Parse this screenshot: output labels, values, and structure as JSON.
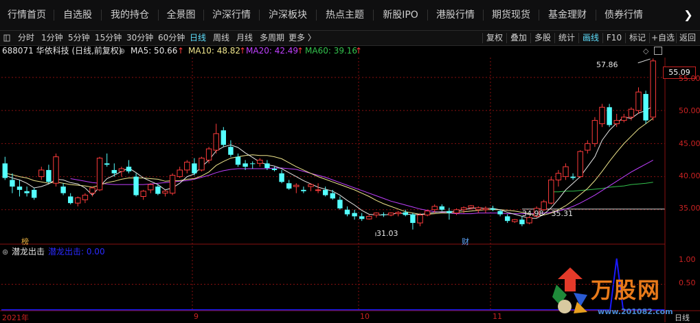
{
  "nav": {
    "items": [
      "行情首页",
      "自选股",
      "我的持仓",
      "全景图",
      "沪深行情",
      "沪深板块",
      "热点主题",
      "新股IPO",
      "港股行情",
      "期货现货",
      "基金理财",
      "债券行情"
    ],
    "next_arrow": "❯"
  },
  "toolbar": {
    "periods": [
      "分时",
      "1分钟",
      "5分钟",
      "15分钟",
      "30分钟",
      "60分钟",
      "日线",
      "周线",
      "月线",
      "多周期",
      "更多 〉"
    ],
    "active_period": "日线",
    "right_buttons": [
      "复权",
      "叠加",
      "多股",
      "统计",
      "画线",
      "F10",
      "标记",
      "+自选",
      "返回"
    ],
    "active_right": "画线"
  },
  "stock": {
    "code_name": "688071 华依科技 (日线,前复权)",
    "ma5": "MA5: 50.66",
    "ma10": "MA10: 48.82",
    "ma20": "MA20: 42.49",
    "ma60": "MA60: 39.16"
  },
  "colors": {
    "up": "#ff3b3b",
    "down": "#54ffff",
    "ma5": "#e6e6e6",
    "ma10": "#f0e68c",
    "ma20": "#c040ff",
    "ma60": "#33c24d",
    "grid": "#8a1010",
    "indicator": "#1a1aff"
  },
  "price_axis": {
    "current": "55.09",
    "ticks": [
      "55.00",
      "50.00",
      "45.00",
      "40.00",
      "35.00"
    ]
  },
  "annotations": {
    "high": "57.86",
    "low": "31.03",
    "range": "34.98 - 35.31",
    "tag_bang": "榜",
    "tag_cai": "财"
  },
  "indicator": {
    "name": "潜龙出击",
    "value_label": "潜龙出击: 0.00",
    "ticks": [
      "1.00",
      "0.50"
    ]
  },
  "x_axis": {
    "labels": [
      "2021年",
      "9",
      "10",
      "11"
    ],
    "period": "日线"
  },
  "watermark": {
    "brand": "万股网",
    "url": "www.201082.com"
  },
  "chart_data": {
    "type": "candlestick",
    "ylim": [
      30,
      58
    ],
    "candles": [
      [
        42.0,
        43.0,
        39.5,
        39.8
      ],
      [
        39.5,
        40.5,
        37.5,
        38.5
      ],
      [
        38.5,
        39.5,
        37.0,
        38.0
      ],
      [
        37.8,
        38.5,
        37.0,
        37.5
      ],
      [
        38.0,
        38.3,
        36.5,
        36.8
      ],
      [
        40.0,
        41.5,
        39.5,
        41.0
      ],
      [
        41.0,
        41.8,
        39.0,
        39.2
      ],
      [
        39.0,
        43.5,
        38.5,
        43.0
      ],
      [
        38.5,
        39.0,
        37.2,
        37.5
      ],
      [
        37.0,
        37.5,
        35.8,
        36.0
      ],
      [
        36.0,
        37.0,
        35.5,
        36.8
      ],
      [
        36.5,
        37.5,
        36.0,
        37.2
      ],
      [
        37.5,
        38.5,
        37.0,
        38.3
      ],
      [
        38.0,
        43.0,
        37.8,
        42.8
      ],
      [
        42.0,
        43.5,
        41.5,
        41.8
      ],
      [
        41.0,
        42.0,
        40.0,
        40.5
      ],
      [
        40.8,
        41.5,
        40.0,
        41.2
      ],
      [
        41.5,
        42.5,
        40.5,
        40.8
      ],
      [
        40.0,
        40.5,
        37.0,
        37.2
      ],
      [
        37.0,
        38.0,
        36.5,
        37.8
      ],
      [
        38.0,
        39.0,
        37.5,
        38.8
      ],
      [
        38.5,
        38.8,
        37.2,
        37.4
      ],
      [
        37.5,
        38.0,
        37.0,
        37.8
      ],
      [
        37.5,
        40.5,
        37.2,
        40.2
      ],
      [
        40.0,
        41.5,
        39.8,
        41.0
      ],
      [
        41.0,
        42.5,
        40.5,
        42.2
      ],
      [
        42.0,
        42.8,
        40.2,
        40.5
      ],
      [
        41.0,
        43.0,
        40.8,
        42.8
      ],
      [
        42.5,
        44.5,
        42.0,
        44.2
      ],
      [
        44.0,
        48.0,
        43.5,
        46.5
      ],
      [
        47.0,
        47.5,
        44.5,
        44.8
      ],
      [
        44.5,
        45.5,
        43.0,
        43.3
      ],
      [
        43.0,
        43.5,
        41.5,
        41.8
      ],
      [
        42.0,
        42.5,
        41.0,
        41.5
      ],
      [
        42.0,
        42.3,
        41.2,
        41.9
      ],
      [
        42.0,
        42.8,
        41.5,
        42.5
      ],
      [
        42.0,
        42.5,
        41.0,
        41.3
      ],
      [
        41.2,
        41.5,
        40.8,
        41.0
      ],
      [
        40.5,
        41.0,
        39.0,
        39.2
      ],
      [
        39.0,
        39.5,
        38.0,
        38.2
      ],
      [
        38.5,
        39.0,
        37.5,
        38.7
      ],
      [
        38.0,
        38.5,
        37.5,
        37.8
      ],
      [
        38.5,
        39.0,
        37.8,
        38.8
      ],
      [
        38.0,
        39.0,
        37.5,
        38.0
      ],
      [
        38.0,
        38.5,
        37.0,
        37.2
      ],
      [
        37.5,
        38.0,
        36.5,
        36.7
      ],
      [
        36.5,
        37.0,
        35.0,
        35.2
      ],
      [
        35.0,
        35.5,
        34.0,
        34.3
      ],
      [
        34.5,
        35.0,
        33.5,
        34.0
      ],
      [
        34.0,
        34.5,
        33.3,
        33.6
      ],
      [
        33.6,
        34.2,
        33.5,
        34.0
      ],
      [
        34.2,
        34.6,
        33.8,
        34.5
      ],
      [
        34.3,
        34.6,
        33.9,
        34.2
      ],
      [
        34.2,
        34.6,
        34.0,
        34.5
      ],
      [
        34.4,
        34.8,
        34.0,
        34.6
      ],
      [
        34.6,
        35.0,
        34.0,
        34.2
      ],
      [
        34.3,
        34.5,
        32.0,
        33.0
      ],
      [
        33.0,
        34.5,
        32.5,
        34.2
      ],
      [
        34.2,
        35.0,
        34.0,
        34.8
      ],
      [
        35.0,
        35.8,
        34.5,
        35.5
      ],
      [
        35.5,
        35.8,
        34.8,
        35.0
      ],
      [
        34.8,
        35.3,
        33.5,
        34.5
      ],
      [
        34.5,
        35.2,
        34.2,
        35.0
      ],
      [
        35.0,
        35.5,
        34.5,
        35.3
      ],
      [
        35.3,
        35.7,
        35.0,
        35.6
      ],
      [
        35.0,
        35.5,
        34.5,
        35.3
      ],
      [
        35.0,
        35.5,
        34.5,
        35.2
      ],
      [
        35.2,
        35.6,
        34.8,
        35.0
      ],
      [
        34.8,
        35.0,
        34.0,
        34.3
      ],
      [
        34.0,
        34.3,
        33.0,
        33.3
      ],
      [
        33.2,
        33.6,
        33.0,
        33.5
      ],
      [
        33.5,
        34.0,
        32.5,
        32.8
      ],
      [
        33.0,
        34.0,
        32.8,
        33.8
      ],
      [
        34.0,
        35.5,
        33.8,
        35.2
      ],
      [
        35.0,
        36.5,
        34.8,
        36.2
      ],
      [
        36.0,
        40.0,
        35.8,
        39.5
      ],
      [
        39.5,
        41.0,
        38.5,
        40.5
      ],
      [
        40.0,
        42.0,
        39.5,
        41.5
      ],
      [
        40.0,
        40.5,
        39.5,
        39.8
      ],
      [
        40.0,
        44.0,
        39.8,
        43.8
      ],
      [
        44.0,
        45.5,
        43.5,
        45.0
      ],
      [
        45.0,
        49.0,
        44.5,
        48.5
      ],
      [
        48.0,
        51.0,
        47.5,
        50.5
      ],
      [
        50.5,
        51.0,
        47.5,
        47.8
      ],
      [
        48.0,
        49.5,
        47.5,
        48.5
      ],
      [
        48.5,
        49.5,
        48.2,
        49.0
      ],
      [
        49.0,
        50.5,
        48.5,
        50.2
      ],
      [
        50.0,
        53.5,
        49.5,
        52.8
      ],
      [
        52.5,
        53.0,
        48.0,
        48.5
      ],
      [
        49.0,
        57.86,
        48.5,
        57.5
      ]
    ],
    "ma5": [
      40.2,
      39.8,
      39.5,
      39.0,
      38.3,
      38.5,
      38.9,
      39.6,
      39.5,
      39.1,
      38.9,
      38.3,
      37.2,
      38.5,
      39.7,
      40.2,
      40.8,
      41.3,
      40.6,
      39.8,
      39.3,
      38.8,
      38.0,
      38.3,
      39.0,
      40.0,
      40.4,
      41.5,
      42.5,
      43.9,
      44.5,
      44.8,
      44.4,
      43.6,
      42.9,
      42.2,
      41.8,
      41.6,
      41.2,
      40.6,
      40.0,
      39.4,
      38.9,
      38.4,
      38.1,
      37.8,
      37.2,
      36.4,
      35.7,
      34.9,
      34.3,
      34.2,
      34.2,
      34.3,
      34.5,
      34.4,
      34.2,
      34.3,
      34.4,
      34.6,
      34.7,
      34.7,
      34.8,
      35.0,
      35.2,
      35.3,
      35.2,
      35.2,
      35.0,
      34.6,
      34.3,
      34.0,
      33.7,
      33.7,
      34.3,
      35.3,
      36.6,
      38.0,
      39.0,
      40.0,
      41.5,
      43.0,
      45.5,
      47.0,
      48.1,
      49.0,
      48.8,
      49.6,
      50.0,
      50.66
    ],
    "ma10": [
      40.5,
      40.3,
      40.0,
      39.8,
      39.4,
      39.2,
      39.0,
      39.2,
      39.0,
      38.8,
      38.7,
      38.6,
      38.4,
      38.7,
      39.1,
      39.3,
      39.6,
      39.8,
      39.8,
      39.8,
      39.7,
      39.6,
      39.3,
      39.4,
      39.4,
      39.6,
      39.7,
      40.1,
      40.7,
      41.7,
      42.3,
      42.8,
      43.0,
      43.2,
      43.3,
      43.2,
      43.2,
      43.0,
      42.7,
      42.1,
      41.5,
      41.0,
      40.5,
      40.0,
      39.6,
      39.2,
      38.8,
      38.4,
      38.0,
      37.5,
      37.0,
      36.4,
      35.9,
      35.5,
      35.1,
      34.7,
      34.5,
      34.3,
      34.3,
      34.4,
      34.5,
      34.5,
      34.6,
      34.7,
      34.8,
      34.9,
      35.0,
      35.0,
      35.0,
      34.9,
      34.8,
      34.6,
      34.4,
      34.2,
      34.2,
      34.5,
      35.0,
      35.6,
      36.4,
      37.3,
      38.2,
      39.4,
      40.8,
      42.3,
      43.7,
      45.0,
      46.1,
      47.2,
      48.0,
      48.82
    ],
    "ma20": [
      null,
      null,
      null,
      null,
      null,
      null,
      null,
      null,
      null,
      39.7,
      39.5,
      39.3,
      39.1,
      39.0,
      38.9,
      38.8,
      38.8,
      38.8,
      38.8,
      38.8,
      38.9,
      39.0,
      39.1,
      39.2,
      39.3,
      39.4,
      39.6,
      39.9,
      40.2,
      40.6,
      40.9,
      41.1,
      41.2,
      41.2,
      41.2,
      41.2,
      41.2,
      41.3,
      41.3,
      41.2,
      41.1,
      40.8,
      40.5,
      40.2,
      39.9,
      39.5,
      39.1,
      38.7,
      38.3,
      37.9,
      37.5,
      37.1,
      36.7,
      36.3,
      36.0,
      35.7,
      35.4,
      35.1,
      34.9,
      34.7,
      34.6,
      34.5,
      34.4,
      34.4,
      34.4,
      34.5,
      34.5,
      34.5,
      34.5,
      34.4,
      34.4,
      34.4,
      34.4,
      34.4,
      34.5,
      34.6,
      34.8,
      35.1,
      35.5,
      36.0,
      36.6,
      37.2,
      37.9,
      38.6,
      39.3,
      40.0,
      40.7,
      41.3,
      41.9,
      42.49
    ],
    "ma60": [
      null,
      null,
      null,
      null,
      null,
      null,
      null,
      null,
      null,
      null,
      null,
      null,
      null,
      null,
      null,
      null,
      null,
      null,
      null,
      null,
      null,
      null,
      null,
      null,
      null,
      null,
      null,
      null,
      null,
      null,
      null,
      null,
      null,
      null,
      null,
      null,
      null,
      null,
      null,
      null,
      null,
      null,
      null,
      null,
      null,
      null,
      null,
      null,
      null,
      null,
      null,
      null,
      null,
      null,
      null,
      null,
      null,
      null,
      null,
      null,
      null,
      null,
      null,
      null,
      null,
      null,
      null,
      null,
      null,
      null,
      null,
      null,
      null,
      null,
      null,
      37.7,
      37.7,
      37.8,
      37.8,
      37.9,
      38.0,
      38.1,
      38.2,
      38.4,
      38.5,
      38.6,
      38.8,
      38.9,
      39.0,
      39.16
    ],
    "indicator": {
      "name": "潜龙出击",
      "values_nonzero": [
        {
          "index": 84,
          "value": 1.0
        }
      ],
      "ylim": [
        0,
        1.2
      ]
    }
  }
}
